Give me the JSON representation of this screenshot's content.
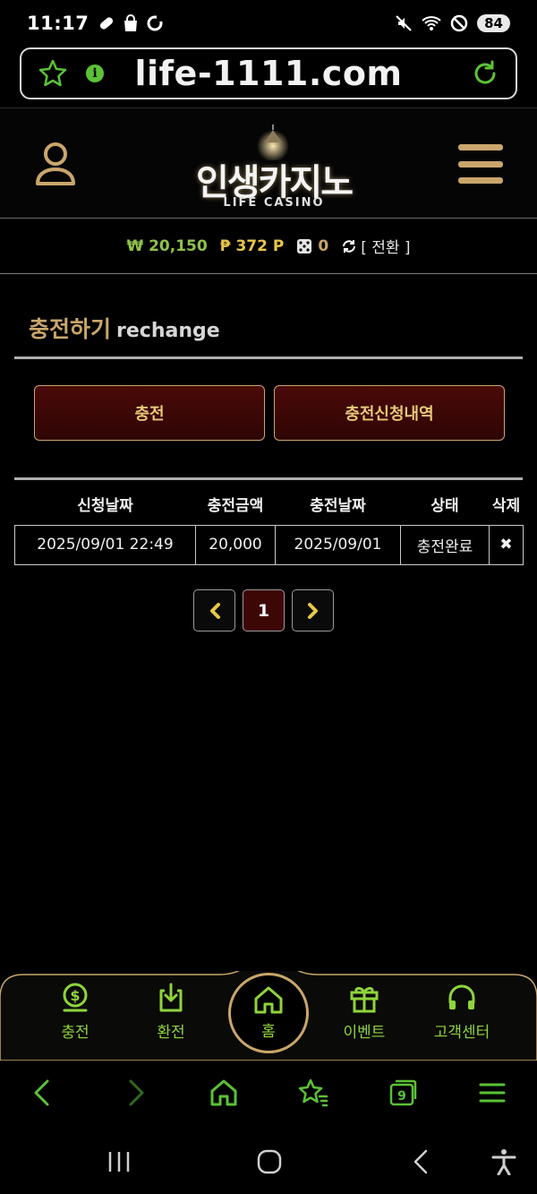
{
  "status_bar": {
    "time": "11:17",
    "battery": "84"
  },
  "browser": {
    "url": "life-1111.com",
    "info_symbol": "i"
  },
  "header": {
    "logo_main": "인생카지노",
    "logo_sub": "LIFE CASINO"
  },
  "wallet": {
    "money": "₩ 20,150",
    "point": "₱ 372 P",
    "chip": "0",
    "convert_label": "[ 전환 ]"
  },
  "page": {
    "title_ko": "충전하기",
    "title_en": "rechange"
  },
  "tabs": {
    "deposit": "충전",
    "history": "충전신청내역"
  },
  "table": {
    "headers": [
      "신청날짜",
      "충전금액",
      "충전날짜",
      "상태",
      "삭제"
    ],
    "rows": [
      {
        "request_date": "2025/09/01 22:49",
        "amount": "20,000",
        "deposit_date": "2025/09/01",
        "status": "충전완료",
        "delete": "✖"
      }
    ]
  },
  "pagination": {
    "current": "1"
  },
  "bottom_nav": {
    "deposit": "충전",
    "withdraw": "환전",
    "home": "홈",
    "event": "이벤트",
    "support": "고객센터"
  },
  "colors": {
    "gold": "#c9a66b",
    "green": "#8fd43c",
    "button_red": "#3d0705"
  }
}
